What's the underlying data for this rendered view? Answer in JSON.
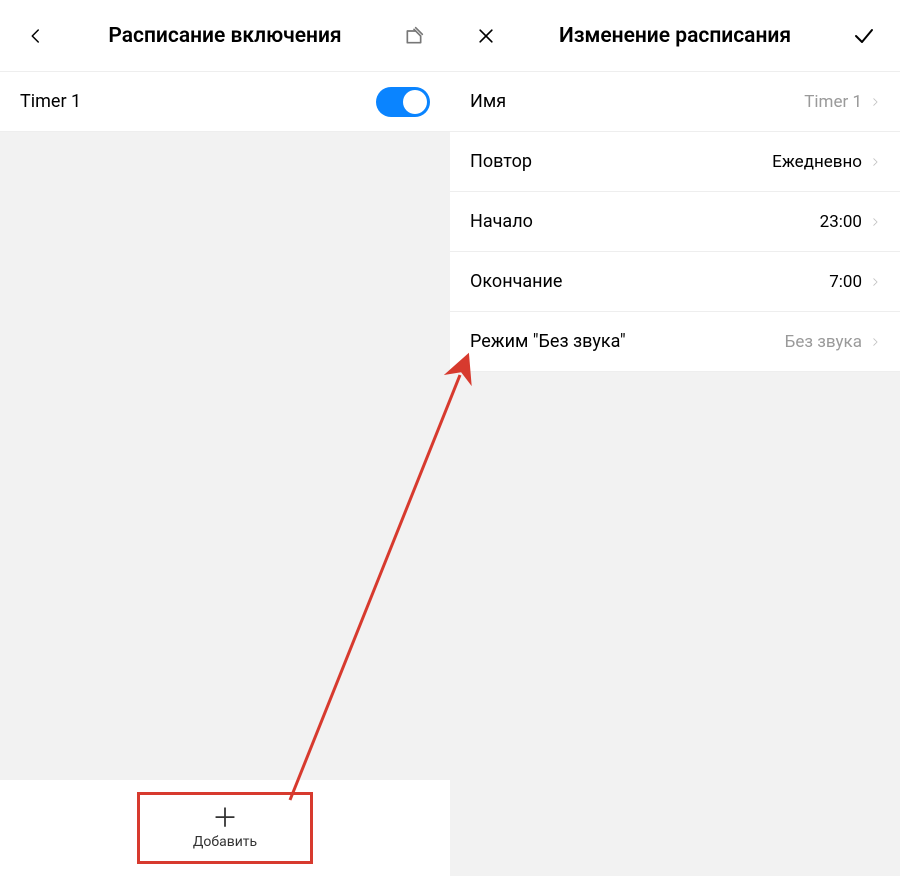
{
  "left": {
    "title": "Расписание включения",
    "timer_row_label": "Timer 1",
    "timer_on": true,
    "add_label": "Добавить"
  },
  "right": {
    "title": "Изменение расписания",
    "rows": {
      "name": {
        "label": "Имя",
        "value": "Timer 1"
      },
      "repeat": {
        "label": "Повтор",
        "value": "Ежедневно"
      },
      "start": {
        "label": "Начало",
        "value": "23:00"
      },
      "end": {
        "label": "Окончание",
        "value": "7:00"
      },
      "silent": {
        "label": "Режим \"Без звука\"",
        "value": "Без звука"
      }
    }
  }
}
